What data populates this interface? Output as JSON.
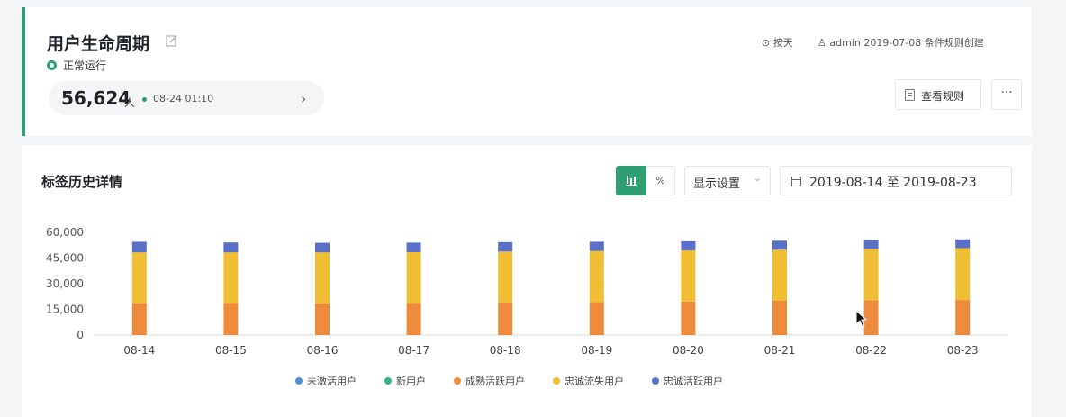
{
  "header": {
    "title": "用户生命周期",
    "status": "正常运行",
    "count": "56,624",
    "count_unit": "人",
    "update_time": "08-24 01:10",
    "frequency": "按天",
    "creator_info": "admin 2019-07-08 条件规则创建",
    "view_rule_label": "查看规则",
    "more_label": "···",
    "edit_icon": "edit-icon",
    "status_icon": "status-dot-icon",
    "arrow_icon": "chevron-right-icon",
    "clock_icon": "clock-icon",
    "user_icon": "user-icon",
    "doc_icon": "document-icon"
  },
  "section": {
    "title": "标签历史详情",
    "toggle_percent_label": "%",
    "display_settings_label": "显示设置",
    "date_range": "2019-08-14 至 2019-08-23",
    "bar_toggle_icon": "bar-chart-icon",
    "calendar_icon": "calendar-icon",
    "chevron_icon": "chevron-down-icon"
  },
  "colors": {
    "accent": "#2f9e72",
    "series": [
      "#4e8fd6",
      "#33b28c",
      "#ee8a3c",
      "#f0be32",
      "#5a6fc8"
    ]
  },
  "chart_data": {
    "type": "bar",
    "stacked": true,
    "categories": [
      "08-14",
      "08-15",
      "08-16",
      "08-17",
      "08-18",
      "08-19",
      "08-20",
      "08-21",
      "08-22",
      "08-23"
    ],
    "y_ticks": [
      "60,000",
      "45,000",
      "30,000",
      "15,000",
      "0"
    ],
    "ylim": [
      0,
      60000
    ],
    "grid": false,
    "legend_position": "bottom",
    "series": [
      {
        "name": "未激活用户",
        "values": [
          0,
          0,
          0,
          0,
          0,
          0,
          0,
          0,
          0,
          0
        ]
      },
      {
        "name": "新用户",
        "values": [
          0,
          0,
          0,
          0,
          0,
          0,
          0,
          0,
          0,
          0
        ]
      },
      {
        "name": "成熟活跃用户",
        "values": [
          18800,
          18700,
          18600,
          18700,
          19100,
          19300,
          19600,
          20000,
          20400,
          20500
        ]
      },
      {
        "name": "忠诚流失用户",
        "values": [
          29500,
          29600,
          29700,
          29700,
          29700,
          29800,
          29800,
          29900,
          30000,
          30300
        ]
      },
      {
        "name": "忠诚活跃用户",
        "values": [
          6200,
          5800,
          5600,
          5600,
          5500,
          5400,
          5400,
          5200,
          5000,
          5100
        ]
      }
    ]
  }
}
